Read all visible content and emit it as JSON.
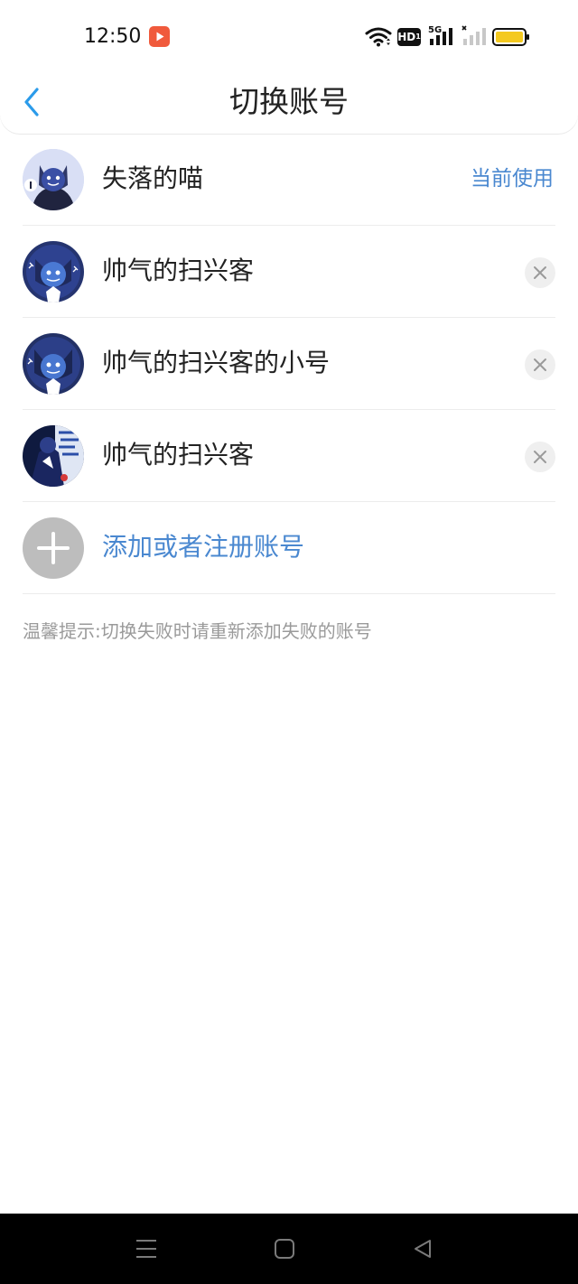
{
  "status_bar": {
    "time": "12:50",
    "app_icon": "video-app-icon",
    "wifi_icon": "wifi-icon",
    "hd_label": "HD",
    "hd_sub": "1",
    "network_label": "5G",
    "battery_color": "#f4c91f",
    "accent_red": "#f05a3c"
  },
  "header": {
    "back_icon": "chevron-left-icon",
    "title": "切换账号"
  },
  "accounts": [
    {
      "name": "失落的喵",
      "status": "当前使用",
      "current": true
    },
    {
      "name": "帅气的扫兴客",
      "current": false
    },
    {
      "name": "帅气的扫兴客的小号",
      "current": false
    },
    {
      "name": "帅气的扫兴客",
      "current": false
    }
  ],
  "add_account": {
    "label": "添加或者注册账号",
    "icon": "plus-icon"
  },
  "tip": "温馨提示:切换失败时请重新添加失败的账号",
  "colors": {
    "accent": "#4a88d0",
    "back_arrow": "#2b9bea",
    "divider": "#ececec",
    "muted": "#9a9a9a"
  },
  "system_nav": {
    "menu_icon": "menu-icon",
    "home_icon": "home-square-icon",
    "back_icon": "back-triangle-icon"
  }
}
